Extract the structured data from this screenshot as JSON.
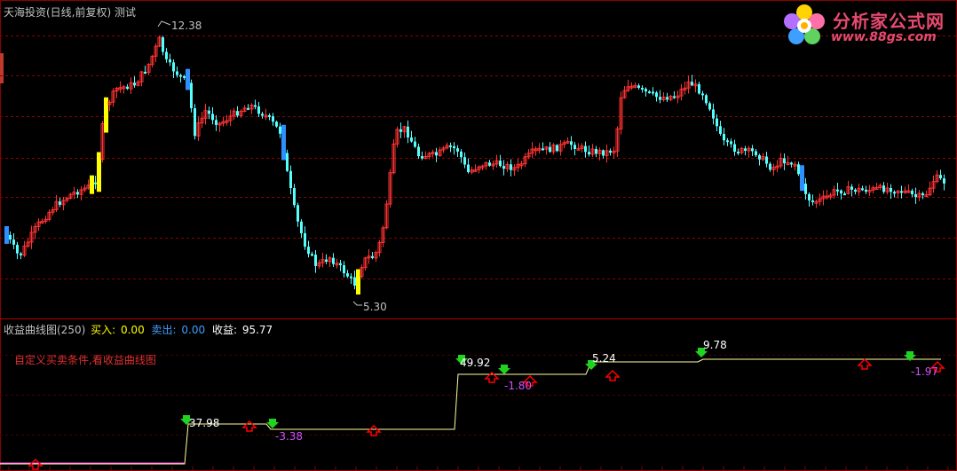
{
  "header": {
    "title": "天海投资(日线,前复权) 测试"
  },
  "logo": {
    "name": "分析家公式网",
    "url": "www.88gs.com"
  },
  "price_chart": {
    "high_label": "12.38",
    "low_label": "5.30",
    "colors": {
      "up": "#ff3232",
      "down": "#54ffff",
      "buy_bar": "#ffff00",
      "sell_bar": "#2f8fff",
      "signal_up": "#ff0000",
      "grid": "#8b0000"
    }
  },
  "indicator": {
    "name": "收益曲线图(250)",
    "buy_label": "买入:",
    "buy_value": "0.00",
    "sell_label": "卖出:",
    "sell_value": "0.00",
    "profit_label": "收益:",
    "profit_value": "95.77",
    "note": "自定义买卖条件,看收益曲线图",
    "labels": [
      {
        "text": "37.98",
        "color": "#ffffff"
      },
      {
        "text": "-3.38",
        "color": "#d050ff"
      },
      {
        "text": "49.92",
        "color": "#ffffff"
      },
      {
        "text": "-1.80",
        "color": "#d050ff"
      },
      {
        "text": "5.24",
        "color": "#ffffff"
      },
      {
        "text": "9.78",
        "color": "#ffffff"
      },
      {
        "text": "-1.97",
        "color": "#d050ff"
      }
    ]
  }
}
